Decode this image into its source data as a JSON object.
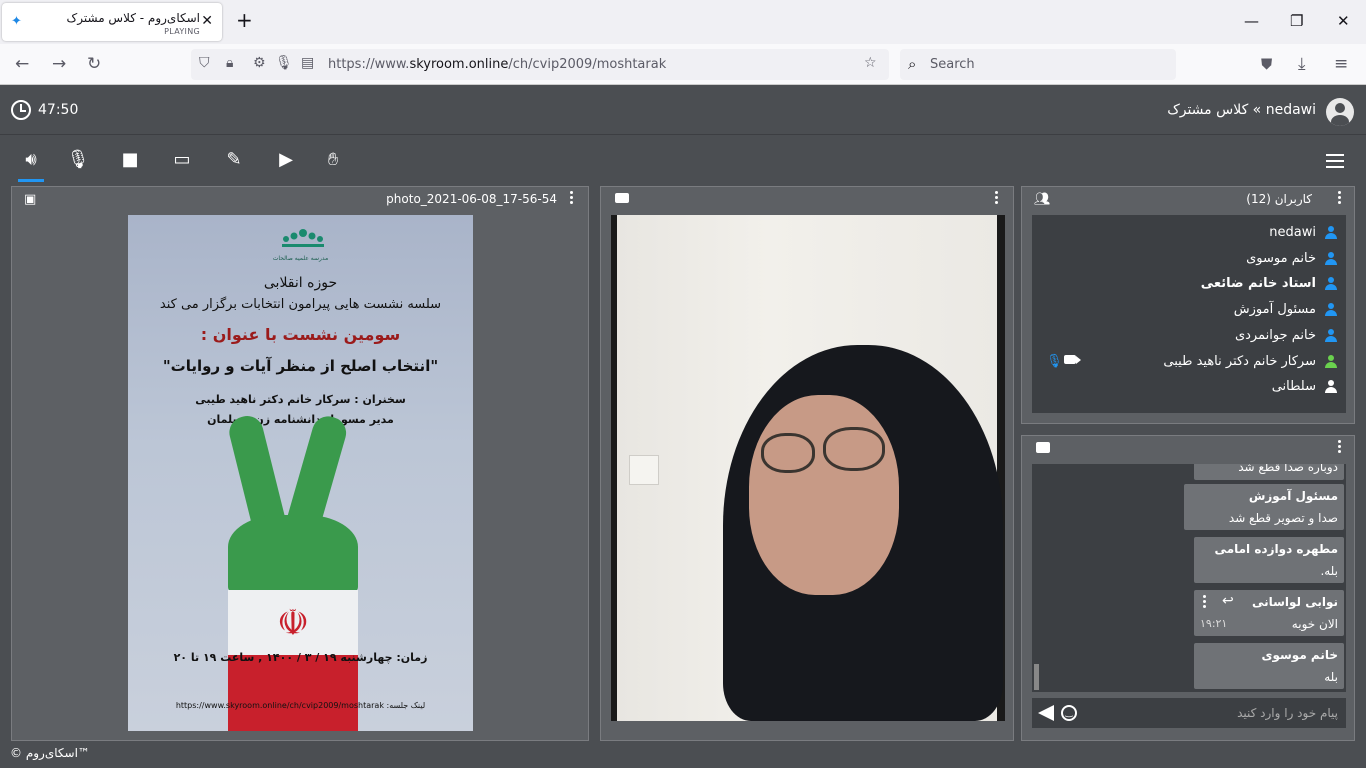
{
  "browser": {
    "tab_title": "اسکای‌روم - کلاس مشترک",
    "tab_status": "PLAYING",
    "new_tab": "+",
    "url_prefix": "https://www.",
    "url_host": "skyroom.online",
    "url_path": "/ch/cvip2009/moshtarak",
    "search_placeholder": "Search"
  },
  "header": {
    "timer": "47:50",
    "room_title": "nedawi » کلاس مشترک"
  },
  "presentation": {
    "title": "photo_2021-06-08_17-56-54",
    "poster": {
      "logo_caption": "مدرسه علمیه صالحات",
      "line1": "حوزه انقلابی",
      "line2": "سلسه نشست هایی  پیرامون انتخابات برگزار می کند",
      "line3": "سومین نشست با عنوان :",
      "line4": "\"انتخاب اصلح از منظر آیات و روایات\"",
      "line5": "سخنران : سرکار خانم دکتر ناهید طیبی",
      "line6": "مدیر مسوول دانشنامه زن مسلمان",
      "line7": "زمان: چهارشنبه ۱۹ / ۳ / ۱۴۰۰   ,   ساعت ۱۹ تا ۲۰",
      "line8": "لینک جلسه: https://www.skyroom.online/ch/cvip2009/moshtarak"
    }
  },
  "users": {
    "title": "کاربران (12)",
    "items": [
      {
        "name": "nedawi",
        "color": "#2196f3",
        "bold": false
      },
      {
        "name": "خانم موسوی",
        "color": "#2196f3",
        "bold": false
      },
      {
        "name": "استاد خانم ضائعی",
        "color": "#2196f3",
        "bold": true
      },
      {
        "name": "مسئول آموزش",
        "color": "#2196f3",
        "bold": false
      },
      {
        "name": "خانم جوانمردی",
        "color": "#2196f3",
        "bold": false
      },
      {
        "name": "سرکار خانم دکتر ناهید طیبی",
        "color": "#6ad14e",
        "bold": false
      },
      {
        "name": "سلطانی",
        "color": "#ffffff",
        "bold": false
      }
    ]
  },
  "chat": {
    "messages": [
      {
        "text": "دوباره صدا قطع شد"
      },
      {
        "author": "مسئول آموزش",
        "text": "صدا و تصویر قطع شد"
      },
      {
        "author": "مطهره دوازده امامی",
        "text": "بله."
      },
      {
        "author": "نوابی لواسانی",
        "text": "الان خوبه",
        "time": "۱۹:۲۱"
      },
      {
        "author": "خانم موسوی",
        "text": "بله"
      }
    ],
    "input_placeholder": "پیام خود را وارد کنید"
  },
  "footer": "© اسکای‌روم™",
  "colors": {
    "accent": "#2196f3",
    "app_bg": "#4b4e52",
    "panel_bg": "#5d6064",
    "list_bg": "#3c3f43"
  }
}
